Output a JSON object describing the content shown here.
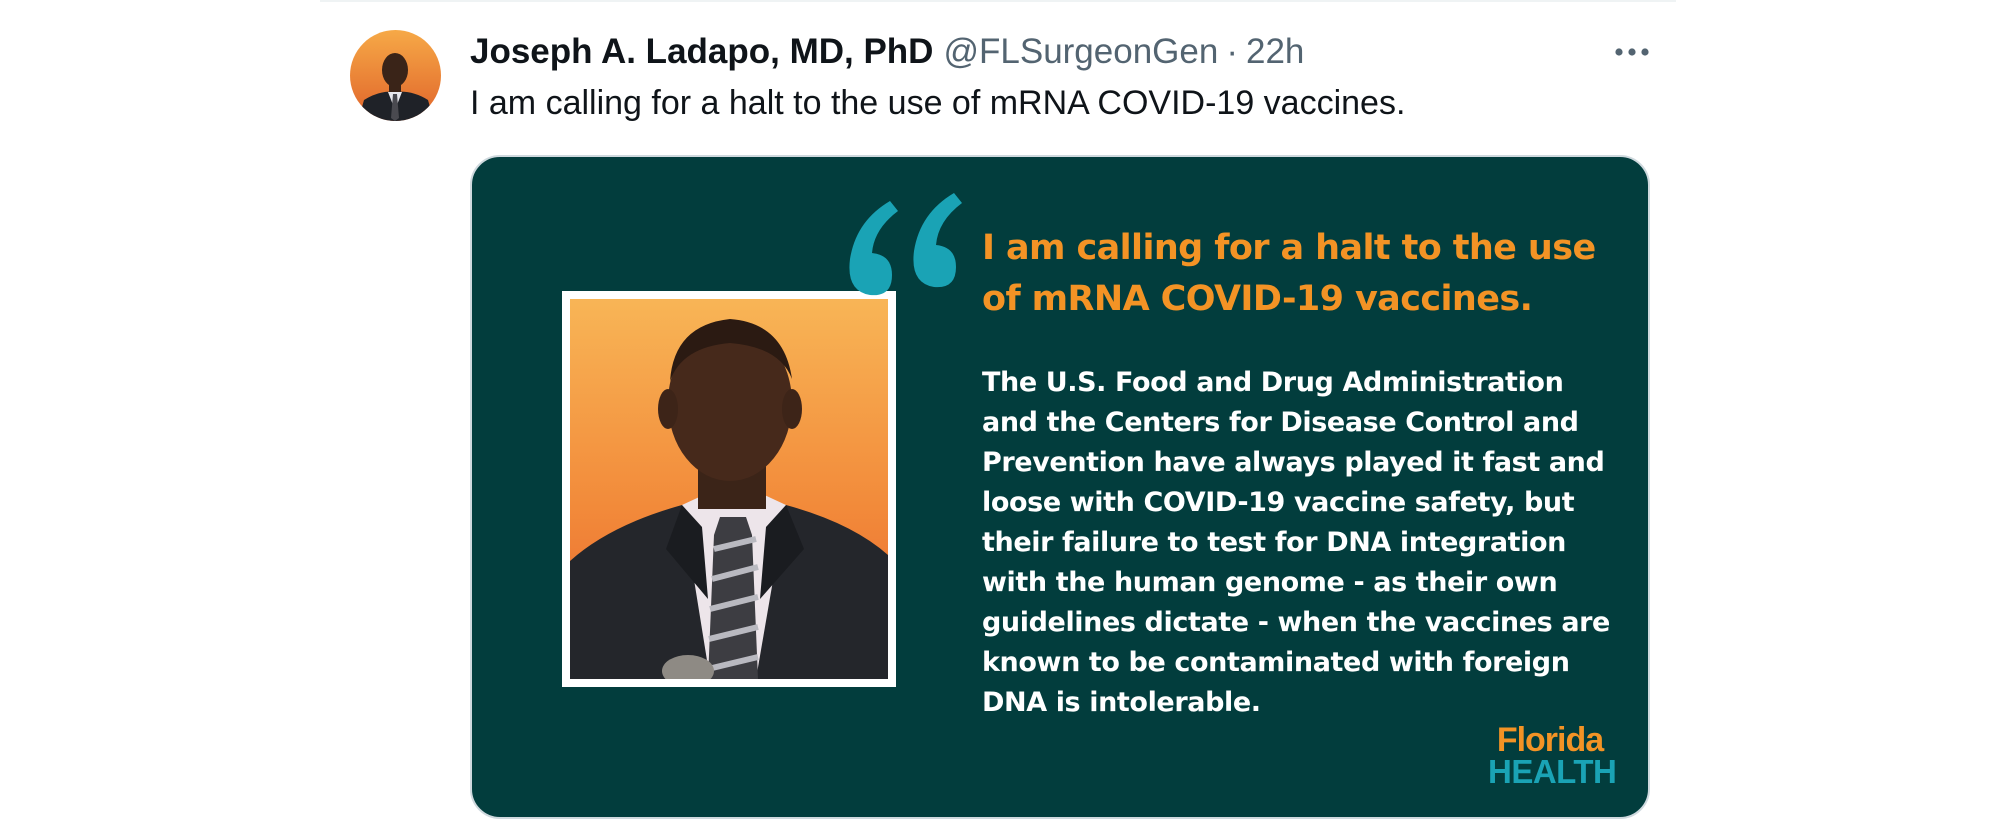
{
  "tweet": {
    "author_name": "Joseph A. Ladapo, MD, PhD",
    "author_handle": "@FLSurgeonGen",
    "separator": "·",
    "timestamp": "22h",
    "text": "I am calling for a halt to the use of mRNA COVID-19 vaccines.",
    "more_icon": "more-horizontal-icon"
  },
  "media": {
    "headline": "I am calling for a halt to the use of mRNA COVID-19 vaccines.",
    "body": "The U.S. Food and Drug Administration and the Centers for Disease Control and Prevention have always played it fast and loose with COVID-19 vaccine safety, but their failure to test for DNA integration with the human genome - as their own guidelines dictate - when the vaccines are known to be contaminated with foreign DNA is intolerable.",
    "logo_line1": "Florida",
    "logo_line2": "HEALTH",
    "quote_icon": "quote-mark-icon"
  },
  "colors": {
    "card_background": "#023d3d",
    "headline_orange": "#f39325",
    "quote_teal": "#1aa3b5",
    "handle_gray": "#536471",
    "text_dark": "#0f1419"
  }
}
